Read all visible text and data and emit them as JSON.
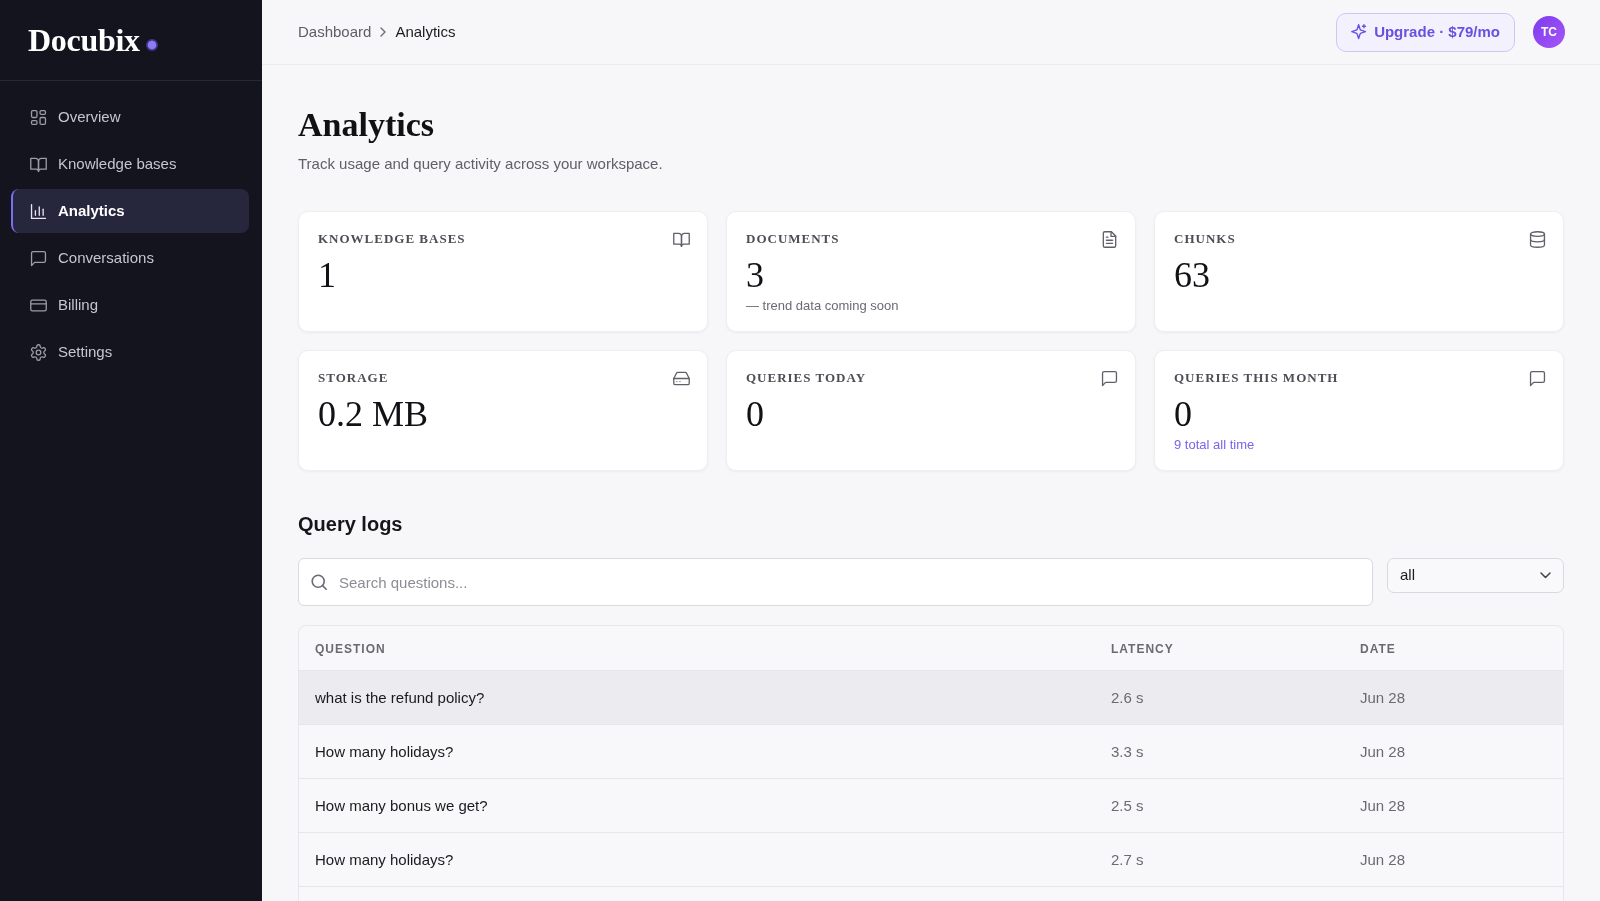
{
  "sidebar": {
    "logo": "Docubix",
    "items": [
      {
        "label": "Overview",
        "selected": false
      },
      {
        "label": "Knowledge bases",
        "selected": false
      },
      {
        "label": "Analytics",
        "selected": true
      },
      {
        "label": "Conversations",
        "selected": false
      },
      {
        "label": "Billing",
        "selected": false
      },
      {
        "label": "Settings",
        "selected": false
      }
    ]
  },
  "header": {
    "breadcrumb": [
      "Dashboard",
      "Analytics"
    ],
    "upgrade_button": "Upgrade · $79/mo",
    "avatar": "TC"
  },
  "page": {
    "title": "Analytics",
    "subtitle": "Track usage and query activity across your workspace."
  },
  "stats": [
    {
      "label": "KNOWLEDGE BASES",
      "value": "1"
    },
    {
      "label": "DOCUMENTS",
      "value": "3",
      "note": {
        "text": "— trend data coming soon",
        "kind": "muted"
      }
    },
    {
      "label": "CHUNKS",
      "value": "63"
    },
    {
      "label": "STORAGE",
      "value": "0.2 MB"
    },
    {
      "label": "QUERIES TODAY",
      "value": "0"
    },
    {
      "label": "QUERIES THIS MONTH",
      "value": "0",
      "note": {
        "text": "9 total all time",
        "kind": "accent"
      }
    }
  ],
  "query_logs": {
    "title": "Query logs",
    "search": {
      "placeholder": "Search questions..."
    },
    "filter": {
      "value": "all"
    },
    "columns": [
      "QUESTION",
      "LATENCY",
      "DATE"
    ],
    "rows": [
      {
        "cells": [
          "what is the refund policy?",
          "2.6 s",
          "Jun 28"
        ],
        "selected": true
      },
      {
        "cells": [
          "How many holidays?",
          "3.3 s",
          "Jun 28"
        ],
        "selected": false
      },
      {
        "cells": [
          "How many bonus we get?",
          "2.5 s",
          "Jun 28"
        ],
        "selected": false
      },
      {
        "cells": [
          "How many holidays?",
          "2.7 s",
          "Jun 28"
        ],
        "selected": false
      }
    ]
  }
}
